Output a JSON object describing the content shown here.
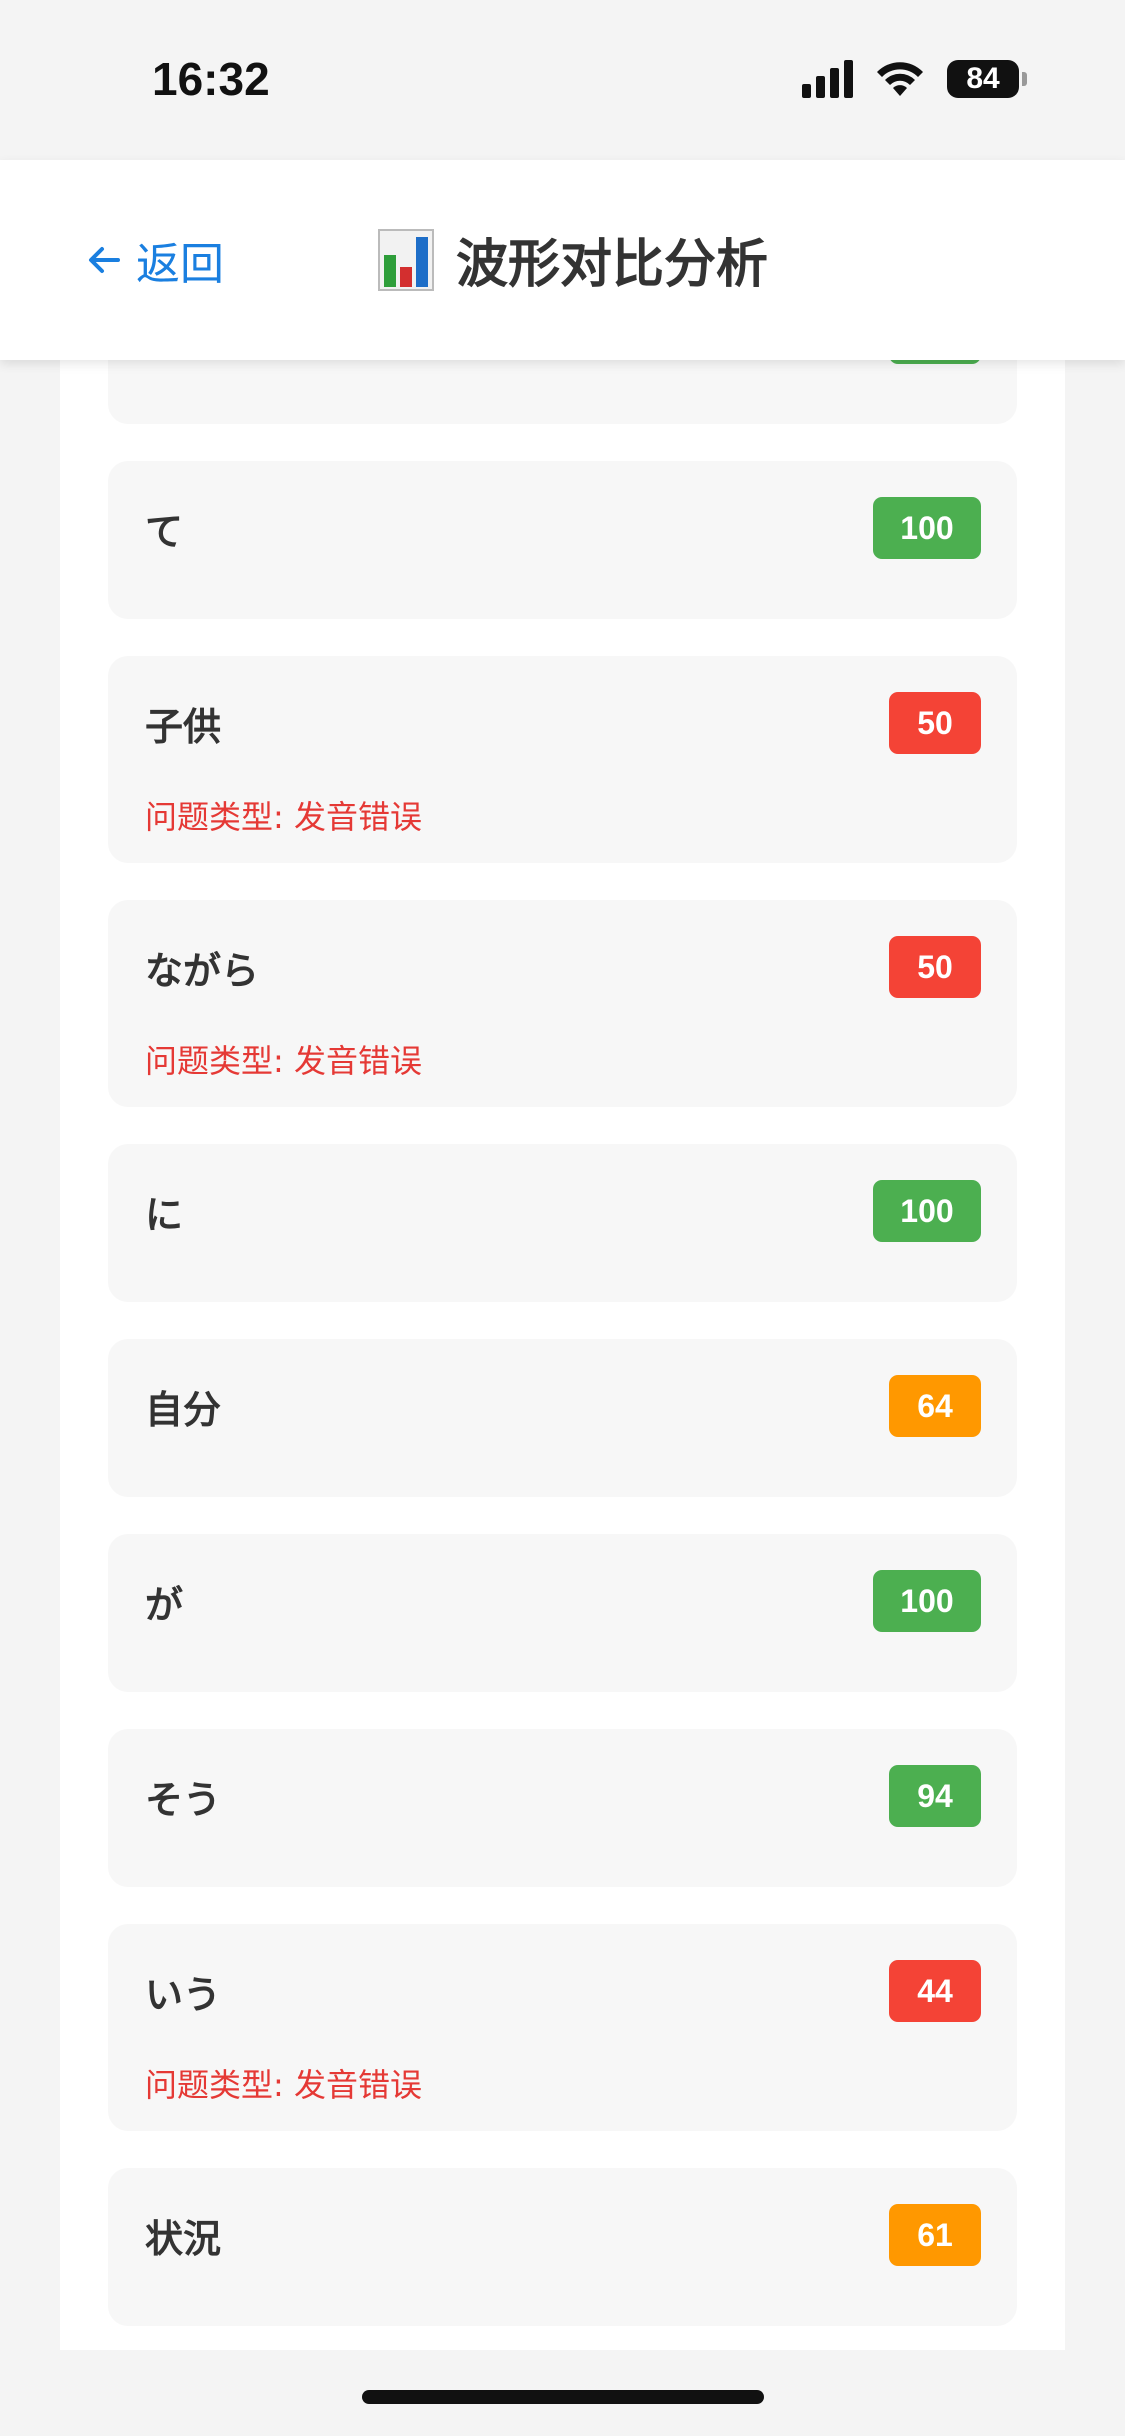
{
  "status_bar": {
    "time": "16:32",
    "battery": "84"
  },
  "nav": {
    "back_label": "返回",
    "title": "波形对比分析",
    "icons": {
      "back": "arrow-left-icon",
      "title": "bar-chart-icon"
    }
  },
  "colors": {
    "accent": "#1a7fe0",
    "good": "#4caf50",
    "medium": "#ff9800",
    "bad": "#f44336",
    "issue_text": "#e53935"
  },
  "words": [
    {
      "word": "",
      "score": "",
      "status": "good",
      "issue": ""
    },
    {
      "word": "て",
      "score": "100",
      "status": "good",
      "issue": ""
    },
    {
      "word": "子供",
      "score": "50",
      "status": "bad",
      "issue": "问题类型: 发音错误"
    },
    {
      "word": "ながら",
      "score": "50",
      "status": "bad",
      "issue": "问题类型: 发音错误"
    },
    {
      "word": "に",
      "score": "100",
      "status": "good",
      "issue": ""
    },
    {
      "word": "自分",
      "score": "64",
      "status": "medium",
      "issue": ""
    },
    {
      "word": "が",
      "score": "100",
      "status": "good",
      "issue": ""
    },
    {
      "word": "そう",
      "score": "94",
      "status": "good",
      "issue": ""
    },
    {
      "word": "いう",
      "score": "44",
      "status": "bad",
      "issue": "问题类型: 发音错误"
    },
    {
      "word": "状況",
      "score": "61",
      "status": "medium",
      "issue": ""
    }
  ]
}
